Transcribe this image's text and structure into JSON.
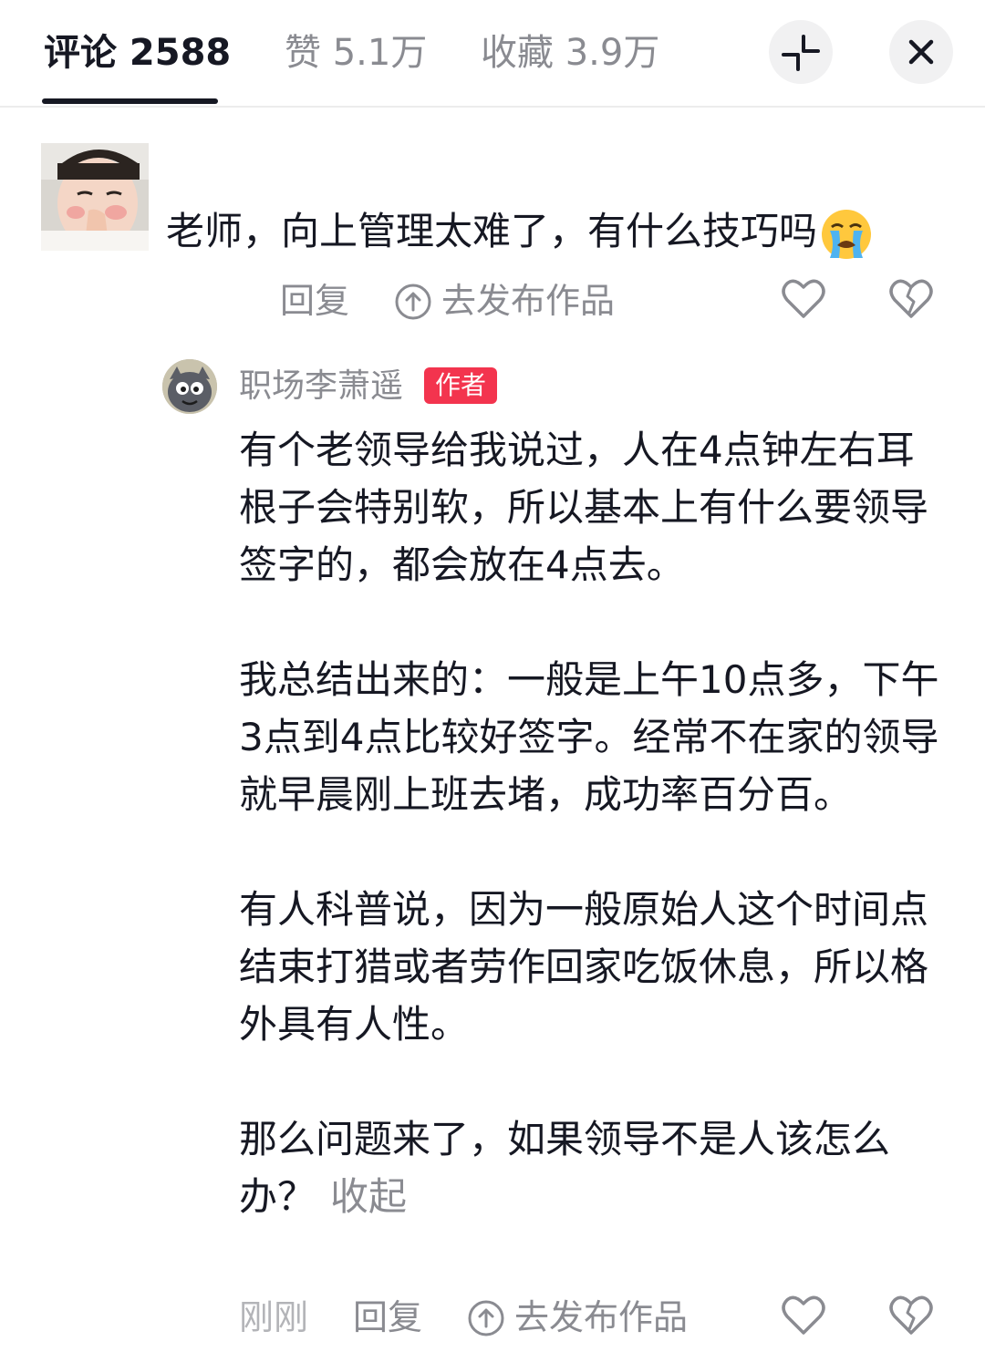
{
  "tabs": {
    "comments": "评论 2588",
    "likes": "赞 5.1万",
    "favorites": "收藏 3.9万"
  },
  "icons": {
    "collapse": "collapse-arrows-icon",
    "close": "close-icon",
    "share": "share-upload-icon",
    "like": "heart-icon",
    "dislike": "broken-heart-icon",
    "emoji": "crying-face-emoji"
  },
  "colors": {
    "text_primary": "#161823",
    "text_secondary": "#8a8b91",
    "badge": "#f3344e",
    "divider": "#ececec"
  },
  "comment": {
    "text": "老师，向上管理太难了，有什么技巧吗",
    "reply_label": "回复",
    "share_label": "去发布作品"
  },
  "reply": {
    "author": "职场李萧遥",
    "badge": "作者",
    "paragraphs": [
      "有个老领导给我说过，人在4点钟左右耳根子会特别软，所以基本上有什么要领导签字的，都会放在4点去。",
      "我总结出来的：一般是上午10点多，下午3点到4点比较好签字。经常不在家的领导就早晨刚上班去堵，成功率百分百。",
      "有人科普说，因为一般原始人这个时间点结束打猎或者劳作回家吃饭休息，所以格外具有人性。",
      "那么问题来了，如果领导不是人该怎么办？"
    ],
    "collapse_label": "收起",
    "time": "刚刚",
    "reply_label": "回复",
    "share_label": "去发布作品"
  }
}
